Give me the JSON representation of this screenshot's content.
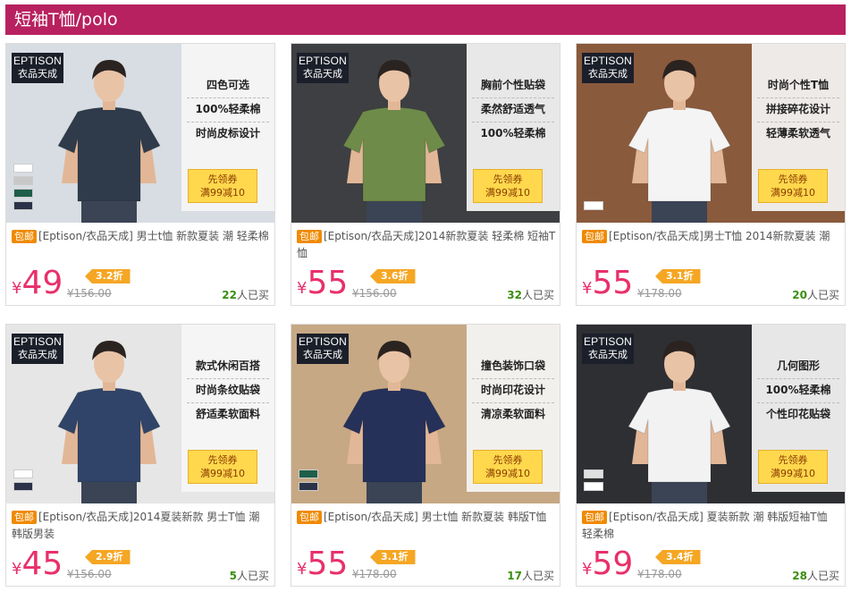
{
  "header": {
    "title": "短袖T恤/polo"
  },
  "colors": {
    "accent": "#b8215f",
    "price": "#e8306a",
    "discount": "#f5a623",
    "free_ship": "#f08a00",
    "sold": "#3a8f10"
  },
  "brand": {
    "en": "EPTISON",
    "cn": "衣品天成"
  },
  "products": [
    {
      "features": [
        "四色可选",
        "100%轻柔棉",
        "时尚皮标设计"
      ],
      "coupon": [
        "先领券",
        "满99减10"
      ],
      "badge": "包邮",
      "title": "[Eptison/衣品天成] 男士t恤 新款夏装 潮 轻柔棉",
      "currency": "¥",
      "price": "49",
      "discount": "3.2折",
      "original": "¥156.00",
      "sold_count": "22",
      "sold_suffix": "人已买",
      "swatches": [
        "#ffffff",
        "#c8c8c8",
        "#1f5e4a",
        "#2c3348"
      ],
      "shirt": "#2f3b4a",
      "bg": "#d8dde3"
    },
    {
      "features": [
        "胸前个性贴袋",
        "柔然舒适透气",
        "100%轻柔棉"
      ],
      "coupon": [
        "先领券",
        "满99减10"
      ],
      "badge": "包邮",
      "title": "[Eptison/衣品天成]2014新款夏装 轻柔棉 短袖T恤",
      "currency": "¥",
      "price": "55",
      "discount": "3.6折",
      "original": "¥156.00",
      "sold_count": "32",
      "sold_suffix": "人已买",
      "swatches": [],
      "shirt": "#6e8b4a",
      "bg": "#3e3f42"
    },
    {
      "features": [
        "时尚个性T恤",
        "拼接碎花设计",
        "轻薄柔软透气"
      ],
      "coupon": [
        "先领券",
        "满99减10"
      ],
      "badge": "包邮",
      "title": "[Eptison/衣品天成]男士T恤 2014新款夏装 潮",
      "currency": "¥",
      "price": "55",
      "discount": "3.1折",
      "original": "¥178.00",
      "sold_count": "20",
      "sold_suffix": "人已买",
      "swatches": [
        "#ffffff"
      ],
      "shirt": "#f4f4f4",
      "bg": "#8a5a3c"
    },
    {
      "features": [
        "款式休闲百搭",
        "时尚条纹贴袋",
        "舒适柔软面料"
      ],
      "coupon": [
        "先领券",
        "满99减10"
      ],
      "badge": "包邮",
      "title": "[Eptison/衣品天成]2014夏装新款 男士T恤 潮 韩版男装",
      "currency": "¥",
      "price": "45",
      "discount": "2.9折",
      "original": "¥156.00",
      "sold_count": "5",
      "sold_suffix": "人已买",
      "swatches": [
        "#ffffff",
        "#2c3348"
      ],
      "shirt": "#2f4468",
      "bg": "#e6e6e6"
    },
    {
      "features": [
        "撞色装饰口袋",
        "时尚印花设计",
        "清凉柔软面料"
      ],
      "coupon": [
        "先领券",
        "满99减10"
      ],
      "badge": "包邮",
      "title": "[Eptison/衣品天成] 男士t恤 新款夏装 韩版T恤",
      "currency": "¥",
      "price": "55",
      "discount": "3.1折",
      "original": "¥178.00",
      "sold_count": "17",
      "sold_suffix": "人已买",
      "swatches": [
        "#1f5e4a",
        "#2c3348"
      ],
      "shirt": "#26315a",
      "bg": "#c6a884"
    },
    {
      "features": [
        "几何图形",
        "100%轻柔棉",
        "个性印花贴袋"
      ],
      "coupon": [
        "先领券",
        "满99减10"
      ],
      "badge": "包邮",
      "title": "[Eptison/衣品天成] 夏装新款 潮 韩版短袖T恤 轻柔棉",
      "currency": "¥",
      "price": "59",
      "discount": "3.4折",
      "original": "¥178.00",
      "sold_count": "28",
      "sold_suffix": "人已买",
      "swatches": [
        "#e0e0e0",
        "#ffffff"
      ],
      "shirt": "#f2f2f2",
      "bg": "#2e2f33"
    }
  ]
}
